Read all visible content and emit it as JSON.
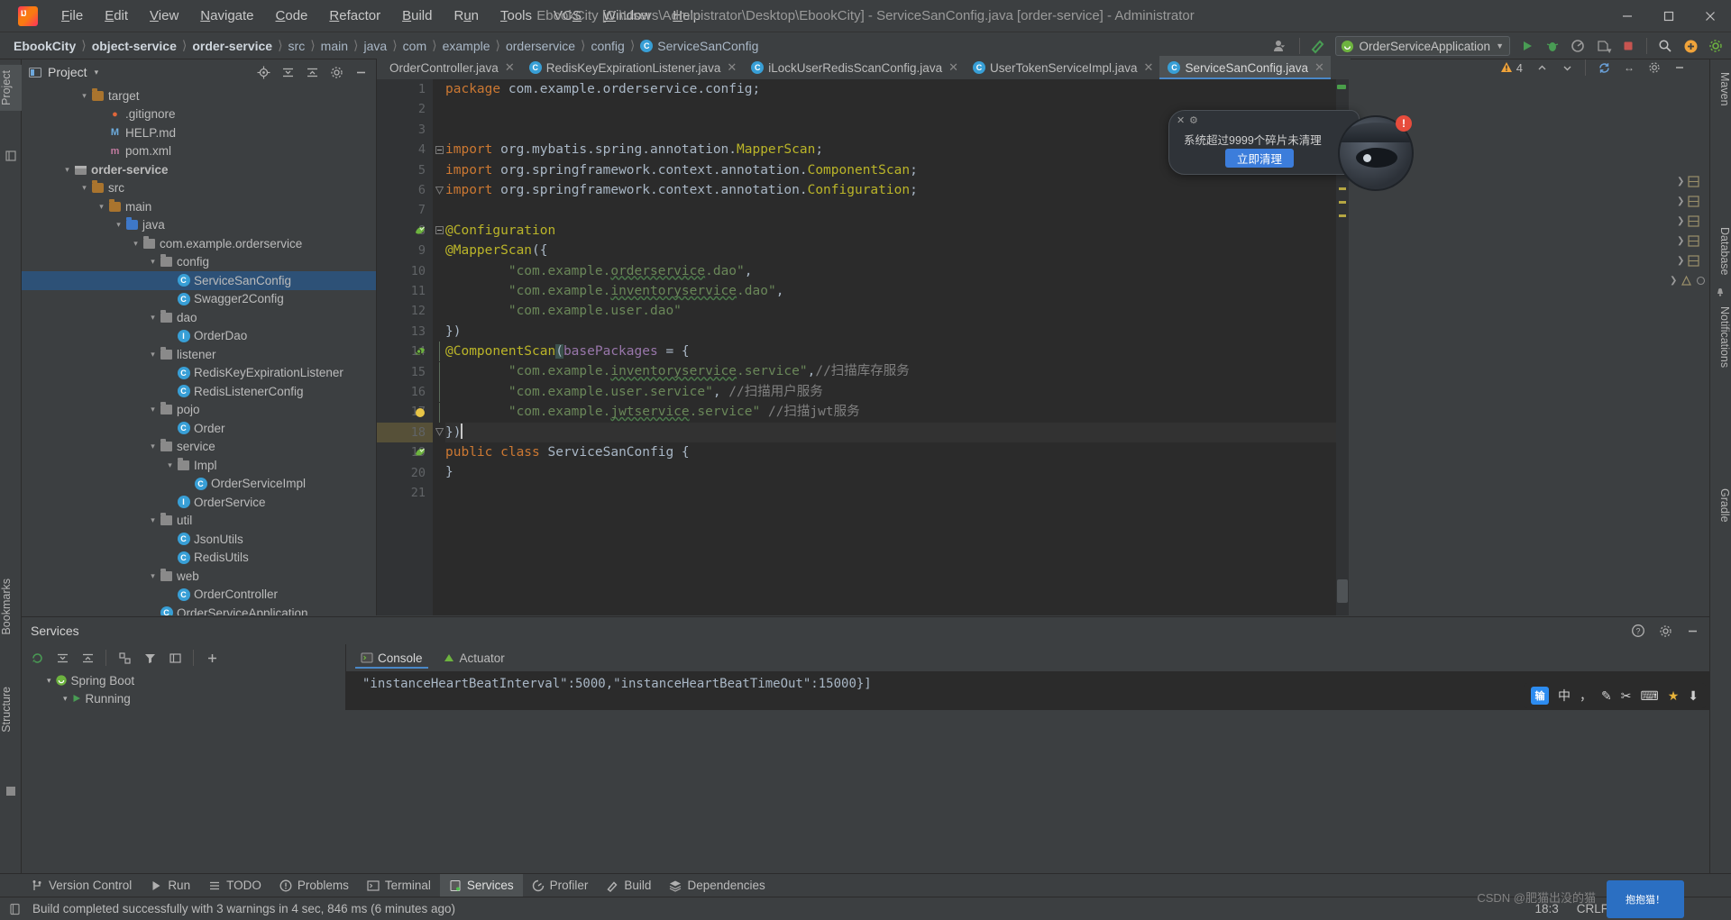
{
  "window": {
    "title": "EbookCity [C:\\Users\\Administrator\\Desktop\\EbookCity] - ServiceSanConfig.java [order-service] - Administrator",
    "minimize": "–",
    "maximize": "❐",
    "close": "✕"
  },
  "menu": [
    {
      "label": "File"
    },
    {
      "label": "Edit"
    },
    {
      "label": "View"
    },
    {
      "label": "Navigate"
    },
    {
      "label": "Code"
    },
    {
      "label": "Refactor"
    },
    {
      "label": "Build"
    },
    {
      "label": "Run"
    },
    {
      "label": "Tools"
    },
    {
      "label": "VCS"
    },
    {
      "label": "Window"
    },
    {
      "label": "Help"
    }
  ],
  "breadcrumbs": [
    {
      "label": "EbookCity",
      "bold": true
    },
    {
      "label": "object-service",
      "bold": true
    },
    {
      "label": "order-service",
      "bold": true
    },
    {
      "label": "src",
      "bold": false
    },
    {
      "label": "main",
      "bold": false
    },
    {
      "label": "java",
      "bold": false
    },
    {
      "label": "com",
      "bold": false
    },
    {
      "label": "example",
      "bold": false
    },
    {
      "label": "orderservice",
      "bold": false
    },
    {
      "label": "config",
      "bold": false
    },
    {
      "label": "ServiceSanConfig",
      "bold": false,
      "icon": "class-icon"
    }
  ],
  "toolbar": {
    "run_config": "OrderServiceApplication",
    "search_icon": "search-icon",
    "settings_icon": "gear-icon",
    "update_icon": "update-project-icon",
    "run_icon": "run-icon",
    "debug_icon": "debug-icon",
    "profile_icon": "profile-icon",
    "coverage_icon": "coverage-icon",
    "stop_icon": "stop-icon",
    "plugin_icon": "plugins-icon",
    "account_icon": "account-icon",
    "build_icon": "build-hammer-icon"
  },
  "left_strip": [
    {
      "label": "Project",
      "selected": true
    },
    {
      "label": "Bookmarks",
      "selected": false
    },
    {
      "label": "Structure",
      "selected": false
    }
  ],
  "right_strip": [
    {
      "label": "Maven"
    },
    {
      "label": "Database"
    },
    {
      "label": "Notifications"
    },
    {
      "label": "Gradle"
    }
  ],
  "project_panel": {
    "title": "Project",
    "dropdown": "▾",
    "actions": [
      "locate-icon",
      "collapse-all-icon",
      "expand-all-icon",
      "settings-icon",
      "hide-icon"
    ],
    "tree": [
      {
        "indent": 3,
        "arrow": "▾",
        "icon": "folder-target",
        "label": "target",
        "bold": false,
        "selected": false
      },
      {
        "indent": 4,
        "arrow": "",
        "icon": "gitignore",
        "label": ".gitignore",
        "bold": false,
        "selected": false
      },
      {
        "indent": 4,
        "arrow": "",
        "icon": "markdown",
        "label": "HELP.md",
        "bold": false,
        "selected": false
      },
      {
        "indent": 4,
        "arrow": "",
        "icon": "maven-pom",
        "label": "pom.xml",
        "bold": false,
        "selected": false
      },
      {
        "indent": 2,
        "arrow": "▾",
        "icon": "module",
        "label": "order-service",
        "bold": true,
        "selected": false
      },
      {
        "indent": 3,
        "arrow": "▾",
        "icon": "folder",
        "label": "src",
        "bold": false,
        "selected": false
      },
      {
        "indent": 4,
        "arrow": "▾",
        "icon": "folder",
        "label": "main",
        "bold": false,
        "selected": false
      },
      {
        "indent": 5,
        "arrow": "▾",
        "icon": "folder-src",
        "label": "java",
        "bold": false,
        "selected": false
      },
      {
        "indent": 6,
        "arrow": "▾",
        "icon": "package",
        "label": "com.example.orderservice",
        "bold": false,
        "selected": false
      },
      {
        "indent": 7,
        "arrow": "▾",
        "icon": "package",
        "label": "config",
        "bold": false,
        "selected": false
      },
      {
        "indent": 8,
        "arrow": "",
        "icon": "class",
        "label": "ServiceSanConfig",
        "bold": false,
        "selected": true
      },
      {
        "indent": 8,
        "arrow": "",
        "icon": "class",
        "label": "Swagger2Config",
        "bold": false,
        "selected": false
      },
      {
        "indent": 7,
        "arrow": "▾",
        "icon": "package",
        "label": "dao",
        "bold": false,
        "selected": false
      },
      {
        "indent": 8,
        "arrow": "",
        "icon": "interface",
        "label": "OrderDao",
        "bold": false,
        "selected": false
      },
      {
        "indent": 7,
        "arrow": "▾",
        "icon": "package",
        "label": "listener",
        "bold": false,
        "selected": false
      },
      {
        "indent": 8,
        "arrow": "",
        "icon": "class",
        "label": "RedisKeyExpirationListener",
        "bold": false,
        "selected": false
      },
      {
        "indent": 8,
        "arrow": "",
        "icon": "class",
        "label": "RedisListenerConfig",
        "bold": false,
        "selected": false
      },
      {
        "indent": 7,
        "arrow": "▾",
        "icon": "package",
        "label": "pojo",
        "bold": false,
        "selected": false
      },
      {
        "indent": 8,
        "arrow": "",
        "icon": "class",
        "label": "Order",
        "bold": false,
        "selected": false
      },
      {
        "indent": 7,
        "arrow": "▾",
        "icon": "package",
        "label": "service",
        "bold": false,
        "selected": false
      },
      {
        "indent": 8,
        "arrow": "▾",
        "icon": "package",
        "label": "Impl",
        "bold": false,
        "selected": false
      },
      {
        "indent": 9,
        "arrow": "",
        "icon": "class",
        "label": "OrderServiceImpl",
        "bold": false,
        "selected": false
      },
      {
        "indent": 8,
        "arrow": "",
        "icon": "interface",
        "label": "OrderService",
        "bold": false,
        "selected": false
      },
      {
        "indent": 7,
        "arrow": "▾",
        "icon": "package",
        "label": "util",
        "bold": false,
        "selected": false
      },
      {
        "indent": 8,
        "arrow": "",
        "icon": "class",
        "label": "JsonUtils",
        "bold": false,
        "selected": false
      },
      {
        "indent": 8,
        "arrow": "",
        "icon": "class",
        "label": "RedisUtils",
        "bold": false,
        "selected": false
      },
      {
        "indent": 7,
        "arrow": "▾",
        "icon": "package",
        "label": "web",
        "bold": false,
        "selected": false
      },
      {
        "indent": 8,
        "arrow": "",
        "icon": "class",
        "label": "OrderController",
        "bold": false,
        "selected": false
      },
      {
        "indent": 7,
        "arrow": "",
        "icon": "class-run",
        "label": "OrderServiceApplication",
        "bold": false,
        "selected": false
      },
      {
        "indent": 7,
        "arrow": "",
        "icon": "folder",
        "label": "",
        "bold": false,
        "selected": false
      }
    ]
  },
  "editor_tabs": [
    {
      "label": "OrderController.java",
      "icon": "java-class-icon",
      "active": false,
      "showIcon": false
    },
    {
      "label": "RedisKeyExpirationListener.java",
      "icon": "java-class-icon",
      "active": false,
      "showIcon": true
    },
    {
      "label": "iLockUserRedisScanConfig.java",
      "icon": "java-class-icon",
      "active": false,
      "showIcon": true
    },
    {
      "label": "UserTokenServiceImpl.java",
      "icon": "java-class-icon",
      "active": false,
      "showIcon": true
    },
    {
      "label": "ServiceSanConfig.java",
      "icon": "java-class-icon",
      "active": true,
      "showIcon": true
    }
  ],
  "inspection": {
    "warning_count": "4",
    "up_icon": "chevron-up-icon",
    "down_icon": "chevron-down-icon",
    "check_icon": "inspection-ok-icon"
  },
  "code": {
    "file": "ServiceSanConfig.java",
    "lines": [
      {
        "n": 1,
        "html": "<span class=\"kw\">package</span> com.example.orderservice.config;"
      },
      {
        "n": 2,
        "html": ""
      },
      {
        "n": 3,
        "html": ""
      },
      {
        "n": 4,
        "html": "<span class=\"kw\">import</span> org.mybatis.spring.annotation.<span class=\"ann\">MapperScan</span>;"
      },
      {
        "n": 5,
        "html": "<span class=\"kw\">import</span> org.springframework.context.annotation.<span class=\"ann\">ComponentScan</span>;"
      },
      {
        "n": 6,
        "html": "<span class=\"kw\">import</span> org.springframework.context.annotation.<span class=\"ann\">Configuration</span>;"
      },
      {
        "n": 7,
        "html": ""
      },
      {
        "n": 8,
        "html": "<span class=\"ann\">@Configuration</span>"
      },
      {
        "n": 9,
        "html": "<span class=\"ann\">@MapperScan</span>({"
      },
      {
        "n": 10,
        "html": "        <span class=\"str\">\"com.example.<span class=\"squig\">orderservice</span>.dao\"</span>,"
      },
      {
        "n": 11,
        "html": "        <span class=\"str\">\"com.example.<span class=\"squig\">inventoryservice</span>.dao\"</span>,"
      },
      {
        "n": 12,
        "html": "        <span class=\"str\">\"com.example.user.dao\"</span>"
      },
      {
        "n": 13,
        "html": "})"
      },
      {
        "n": 14,
        "html": "<span class=\"ann\">@ComponentScan</span><span class=\"hlbrace\">(</span><span class=\"param\">basePackages</span> = {"
      },
      {
        "n": 15,
        "html": "        <span class=\"str\">\"com.example.<span class=\"squig\">inventoryservice</span>.service\"</span>,<span class=\"cmt\">//扫描库存服务</span>"
      },
      {
        "n": 16,
        "html": "        <span class=\"str\">\"com.example.user.service\"</span>, <span class=\"cmt\">//扫描用户服务</span>"
      },
      {
        "n": 17,
        "html": "        <span class=\"str\">\"com.example.<span class=\"squig\">jwtservice</span>.service\"</span> <span class=\"cmt\">//扫描jwt服务</span>"
      },
      {
        "n": 18,
        "html": "})<span class=\"cursor\"></span>"
      },
      {
        "n": 19,
        "html": "<span class=\"kw\">public class</span> ServiceSanConfig {"
      },
      {
        "n": 20,
        "html": "}"
      },
      {
        "n": 21,
        "html": ""
      }
    ],
    "current_line": 18,
    "gutter_icons": [
      {
        "line": 8,
        "icon": "spring-bean-icon"
      },
      {
        "line": 14,
        "icon": "spring-scan-icon"
      },
      {
        "line": 17,
        "icon": "intention-bulb-icon"
      },
      {
        "line": 19,
        "icon": "spring-bean-icon"
      }
    ]
  },
  "notification": {
    "close": "✕",
    "gear": "⚙",
    "text": "系统超过9999个碎片未清理",
    "button": "立即清理",
    "badge": "!"
  },
  "services": {
    "title": "Services",
    "toolbar_icons": [
      "rerun-icon",
      "collapse-icon",
      "expand-icon",
      "group-icon",
      "filter-icon",
      "show-icon",
      "add-icon"
    ],
    "head_actions": [
      "help-icon",
      "settings-icon",
      "hide-icon"
    ],
    "tree": [
      {
        "indent": 1,
        "arrow": "▾",
        "icon": "spring-boot-icon",
        "label": "Spring Boot"
      },
      {
        "indent": 2,
        "arrow": "▾",
        "icon": "run-green-icon",
        "label": "Running"
      }
    ],
    "tabs": [
      {
        "label": "Console",
        "icon": "console-icon",
        "active": true
      },
      {
        "label": "Actuator",
        "icon": "actuator-icon",
        "active": false
      }
    ],
    "console_text": "\"instanceHeartBeatInterval\":5000,\"instanceHeartBeatTimeOut\":15000}]"
  },
  "ime": {
    "logo": "中",
    "items": [
      "中",
      "，",
      "✎",
      "✂",
      "⌨",
      "★",
      "⬇"
    ]
  },
  "tool_windows": [
    {
      "label": "Version Control",
      "icon": "vcs-icon",
      "active": false
    },
    {
      "label": "Run",
      "icon": "run-icon",
      "active": false
    },
    {
      "label": "TODO",
      "icon": "todo-icon",
      "active": false
    },
    {
      "label": "Problems",
      "icon": "problems-icon",
      "active": false
    },
    {
      "label": "Terminal",
      "icon": "terminal-icon",
      "active": false
    },
    {
      "label": "Services",
      "icon": "services-icon",
      "active": true
    },
    {
      "label": "Profiler",
      "icon": "profiler-icon",
      "active": false
    },
    {
      "label": "Build",
      "icon": "build-icon",
      "active": false
    },
    {
      "label": "Dependencies",
      "icon": "dependencies-icon",
      "active": false
    }
  ],
  "status": {
    "message": "Build completed successfully with 3 warnings in 4 sec, 846 ms (6 minutes ago)",
    "message_icon": "build-status-icon",
    "time": "18:3",
    "encoding": "CRLF",
    "watermark": "CSDN @肥猫出没的猫",
    "taskbar": "抱抱猫！"
  }
}
